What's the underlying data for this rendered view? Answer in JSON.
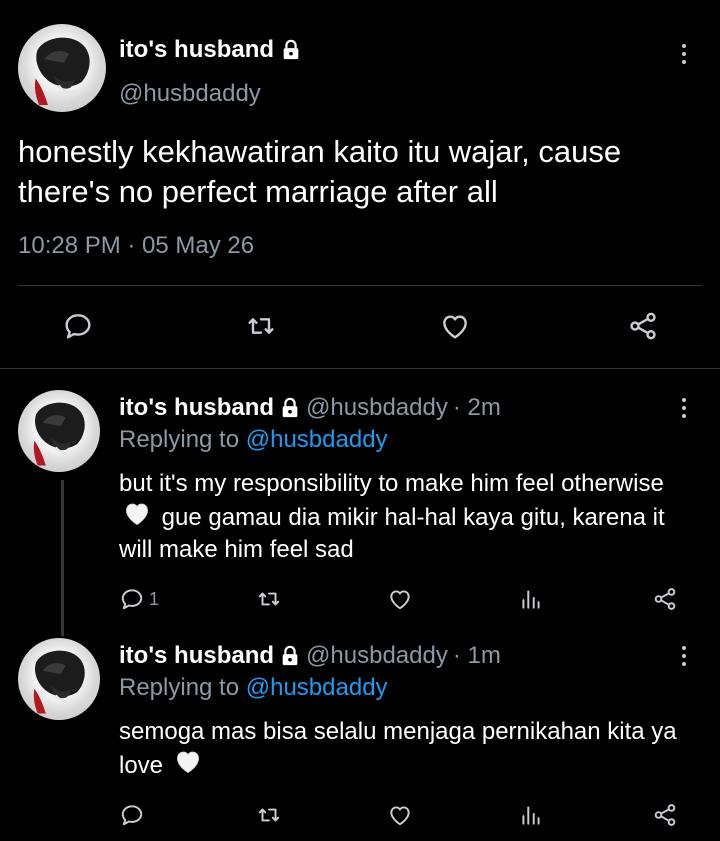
{
  "main_tweet": {
    "display_name": "ito's husband",
    "handle": "@husbdaddy",
    "text": "honestly kekhawatiran kaito itu wajar, cause there's no perfect marriage after all",
    "timestamp": "10:28 PM · 05 May 26",
    "actions": [
      "reply-icon",
      "retweet-icon",
      "like-icon",
      "share-icon"
    ]
  },
  "replies": [
    {
      "display_name": "ito's husband",
      "handle": "@husbdaddy",
      "time": "· 2m",
      "replying_prefix": "Replying to",
      "replying_to": "@husbdaddy",
      "text_part1": "but it's my responsibility to make him feel otherwise",
      "text_part2": "gue gamau dia mikir hal-hal kaya gitu, karena it will make him feel sad",
      "reply_count": "1"
    },
    {
      "display_name": "ito's husband",
      "handle": "@husbdaddy",
      "time": "· 1m",
      "replying_prefix": "Replying to",
      "replying_to": "@husbdaddy",
      "text_part1": "semoga mas bisa selalu menjaga pernikahan kita ya love",
      "reply_count": ""
    }
  ],
  "colors": {
    "background": "#000000",
    "text": "#ffffff",
    "secondary": "#8b98a5",
    "link": "#1d9bf0",
    "divider": "#2f3336"
  }
}
